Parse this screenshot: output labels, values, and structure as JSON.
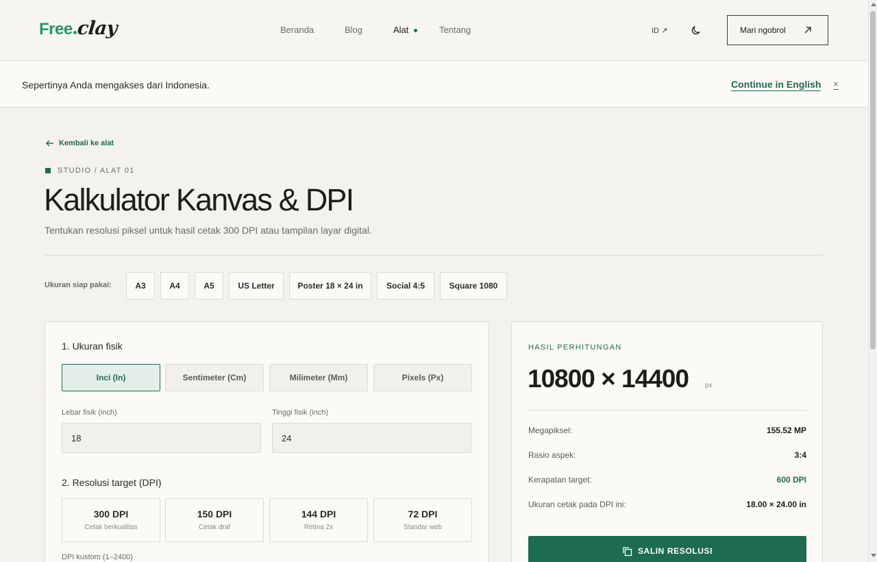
{
  "header": {
    "logo_free": "Free",
    "logo_clay": "clay",
    "nav": [
      {
        "label": "Beranda",
        "active": false
      },
      {
        "label": "Blog",
        "active": false
      },
      {
        "label": "Alat",
        "active": true
      },
      {
        "label": "Tentang",
        "active": false
      }
    ],
    "lang": "ID ↗",
    "theme_icon": "moon-icon",
    "chat_label": "Mari ngobrol",
    "chat_icon": "arrow-up-right-icon"
  },
  "banner": {
    "text": "Sepertinya Anda mengakses dari Indonesia.",
    "link": "Continue in English",
    "close": "×"
  },
  "page": {
    "back": "Kembali ke alat",
    "eyebrow": "STUDIO / ALAT 01",
    "title": "Kalkulator Kanvas & DPI",
    "subtitle": "Tentukan resolusi piksel untuk hasil cetak 300 DPI atau tampilan layar digital."
  },
  "presets": {
    "label": "Ukuran siap pakai:",
    "items": [
      "A3",
      "A4",
      "A5",
      "US Letter",
      "Poster 18 × 24 in",
      "Social 4:5",
      "Square 1080"
    ]
  },
  "form": {
    "section1": "1. Ukuran fisik",
    "units": [
      {
        "label": "Inci (In)",
        "active": true
      },
      {
        "label": "Sentimeter (Cm)",
        "active": false
      },
      {
        "label": "Milimeter (Mm)",
        "active": false
      },
      {
        "label": "Pixels (Px)",
        "active": false
      }
    ],
    "width_label": "Lebar fisik (inch)",
    "width_value": "18",
    "height_label": "Tinggi fisik (inch)",
    "height_value": "24",
    "section2": "2. Resolusi target (DPI)",
    "dpi_options": [
      {
        "value": "300 DPI",
        "sub": "Cetak berkualitas"
      },
      {
        "value": "150 DPI",
        "sub": "Cetak draf"
      },
      {
        "value": "144 DPI",
        "sub": "Retina 2x"
      },
      {
        "value": "72 DPI",
        "sub": "Standar web"
      }
    ],
    "custom_label": "DPI kustom (1–2400)"
  },
  "result": {
    "label": "HASIL PERHITUNGAN",
    "value": "10800 × 14400",
    "unit": "px",
    "rows": [
      {
        "key": "Megapiksel:",
        "value": "155.52 MP"
      },
      {
        "key": "Rasio aspek:",
        "value": "3:4"
      },
      {
        "key": "Kerapatan target:",
        "value": "600 DPI"
      },
      {
        "key": "Ukuran cetak pada DPI ini:",
        "value": "18.00 × 24.00 in"
      }
    ],
    "copy_label": "SALIN RESOLUSI",
    "copy_icon": "copy-icon",
    "accent_color": "#1d6b50"
  }
}
